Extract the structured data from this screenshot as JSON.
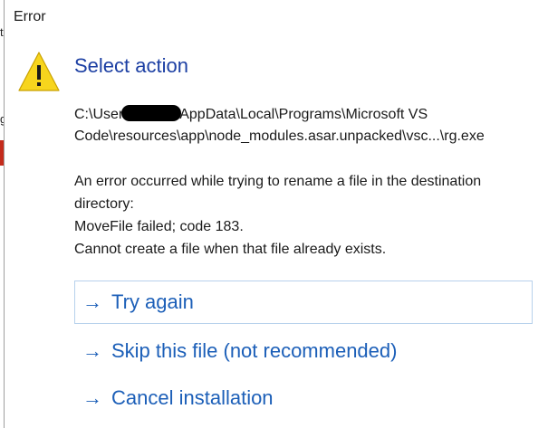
{
  "dialog": {
    "title": "Error",
    "heading": "Select action",
    "path_before_redaction": "C:\\User",
    "path_after_redaction": "AppData\\Local\\Programs\\Microsoft VS",
    "path_line2": "Code\\resources\\app\\node_modules.asar.unpacked\\vsc...\\rg.exe",
    "message_lines": [
      "An error occurred while trying to rename a file in the destination",
      "directory:",
      "MoveFile failed; code 183.",
      "Cannot create a file when that file already exists."
    ]
  },
  "commands": [
    {
      "label": "Try again",
      "icon": "right-arrow-icon"
    },
    {
      "label": "Skip this file (not recommended)",
      "icon": "right-arrow-icon"
    },
    {
      "label": "Cancel installation",
      "icon": "right-arrow-icon"
    }
  ],
  "colors": {
    "heading": "#1c3fa3",
    "command_link": "#1c5fb8",
    "warning_fill": "#f7d51d",
    "focus_border": "#b7d1ec"
  },
  "icons": {
    "warning": "warning-icon"
  }
}
